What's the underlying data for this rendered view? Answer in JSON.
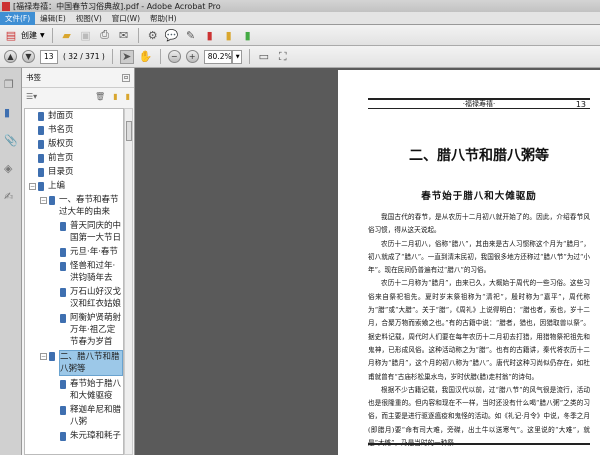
{
  "window": {
    "title": "[福禄寿禧：中国春节习俗典故].pdf - Adobe Acrobat Pro"
  },
  "menu": [
    "文件(F)",
    "编辑(E)",
    "视图(V)",
    "窗口(W)",
    "帮助(H)"
  ],
  "toolbar": {
    "create_label": "创建"
  },
  "nav": {
    "page_input": "13",
    "page_count": "( 32 / 371 )",
    "zoom": "80.2%"
  },
  "bookmarks_panel": {
    "title": "书签"
  },
  "bookmarks": [
    {
      "label": "封面页",
      "level": 0
    },
    {
      "label": "书名页",
      "level": 0
    },
    {
      "label": "版权页",
      "level": 0
    },
    {
      "label": "前言页",
      "level": 0
    },
    {
      "label": "目录页",
      "level": 0
    },
    {
      "label": "上编",
      "level": 0,
      "toggle": "⊟"
    },
    {
      "label": "一、春节和春节过大年的由来",
      "level": 1,
      "toggle": "⊟"
    },
    {
      "label": "普天同庆的中国第一大节日",
      "level": 2
    },
    {
      "label": "元旦·年·春节",
      "level": 2
    },
    {
      "label": "怪兽和过年·洪钧骑年去",
      "level": 2
    },
    {
      "label": "万石山好汉戈汉和红衣姑娘",
      "level": 2
    },
    {
      "label": "阿衡妒贤萌射万年·祖乙定节春为岁首",
      "level": 2
    },
    {
      "label": "二、腊八节和腊八粥等",
      "level": 1,
      "toggle": "⊟",
      "selected": true
    },
    {
      "label": "春节始于腊八和大傩驱疫",
      "level": 2
    },
    {
      "label": "释迦牟尼和腊八粥",
      "level": 2
    },
    {
      "label": "朱元璋和耗子",
      "level": 2
    }
  ],
  "page": {
    "running_head": "·福禄寿禧·",
    "page_number": "13",
    "chapter_title": "二、腊八节和腊八粥等",
    "section_title": "春节始于腊八和大傩驱励",
    "paragraphs": [
      "我国古代的春节，是从农历十二月初八就开始了的。因此，介绍春节风俗习惯，得从这天说起。",
      "农历十二月初八，俗称“腊八”，其由来是古人习惯称这个月为“腊月”，初八就成了“腊八”。一直到清末民初，我国很多地方还称过“腊八节”为过“小年”。现在民间仍普遍有过“腊八”的习俗。",
      "农历十二月称为“腊月”，由来已久，大概始于周代的一些习俗。这些习俗来自祭祀祖先。夏时岁末祭祖称为“清祀”，殷时称为“嘉平”，周代称为“腊”或“大腊”。关于“腊”，《周礼》上说得明白：“腊也者，索也，岁十二月，合聚万物而索飨之也。”有的古籍中说：“腊者，猎也，因猎取兽以祭”。据史料记载，周代时人们要在每年农历十二月初去打猎，用猎物祭祀祖先和鬼神，已形成风俗。这种活动称之为“腊”。也有的古籍讲，秦代将农历十二月称为“腊月”，这个月的初八称为“腊八”。唐代时这种习尚似仍存在，如杜甫就曾有“古庙杉松巢水鸟，岁时伏腊(腊)走村翁”的诗句。",
      "根据不少古籍记载，我国汉代以前，过“腊八节”的风气很是流行，活动也是很隆重的。但内容和现在不一样，当时还没有什么喝“腊八粥”之类的习俗，而主要是进行驱逐瘟疫和鬼怪的活动。如《礼记·月令》中说，冬季之月(即腊月)要“命有司大难，旁磔，出土牛以送寒气”。这里说的“大难”，就是“大傩”，乃是当时的一种祭"
    ]
  }
}
